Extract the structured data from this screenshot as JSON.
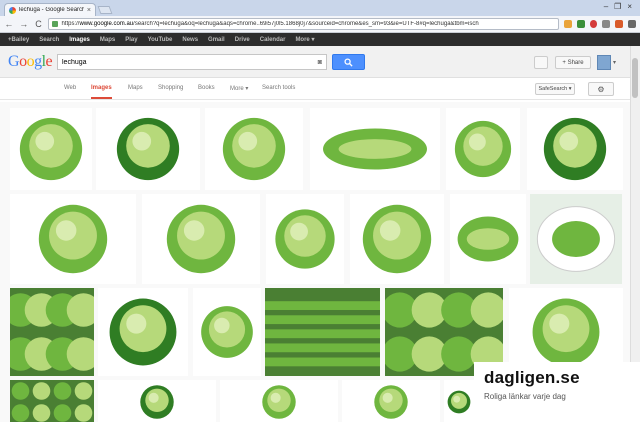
{
  "browser": {
    "tab_title": "lechuga - Google Search",
    "tab_close": "×",
    "window_controls": [
      "–",
      "❐",
      "×"
    ],
    "nav": {
      "back": "←",
      "forward": "→",
      "reload": "C"
    },
    "url_prefix": "https://",
    "url_domain": "www.google.com.au",
    "url_rest": "/search?q=lechuga&oq=lechuga&aqs=chrome..69i57j0l5.1868j0j7&sourceid=chrome&es_sm=93&ie=UTF-8#q=lechuga&tbm=isch"
  },
  "gbar": {
    "items": [
      "+Bailey",
      "Search",
      "Images",
      "Maps",
      "Play",
      "YouTube",
      "News",
      "Gmail",
      "Drive",
      "Calendar",
      "More ▾"
    ],
    "active_index": 2
  },
  "header": {
    "logo_letters": [
      "G",
      "o",
      "o",
      "g",
      "l",
      "e"
    ],
    "query": "lechuga",
    "share_label": "+ Share"
  },
  "tabs": {
    "items": [
      "Web",
      "Images",
      "Maps",
      "Shopping",
      "Books",
      "More ▾",
      "Search tools"
    ],
    "active_index": 1,
    "safesearch_label": "SafeSearch ▾",
    "settings_icon": "⚙"
  },
  "watermark": {
    "title": "dagligen.se",
    "subtitle": "Roliga länkar varje dag"
  },
  "colors": {
    "link_active": "#dd4b39",
    "search_button": "#4d90fe",
    "gbar_bg": "#2d2d2d",
    "lettuce_light": "#b6d97a",
    "lettuce_mid": "#6fb63f",
    "lettuce_dark": "#2f7d23"
  }
}
